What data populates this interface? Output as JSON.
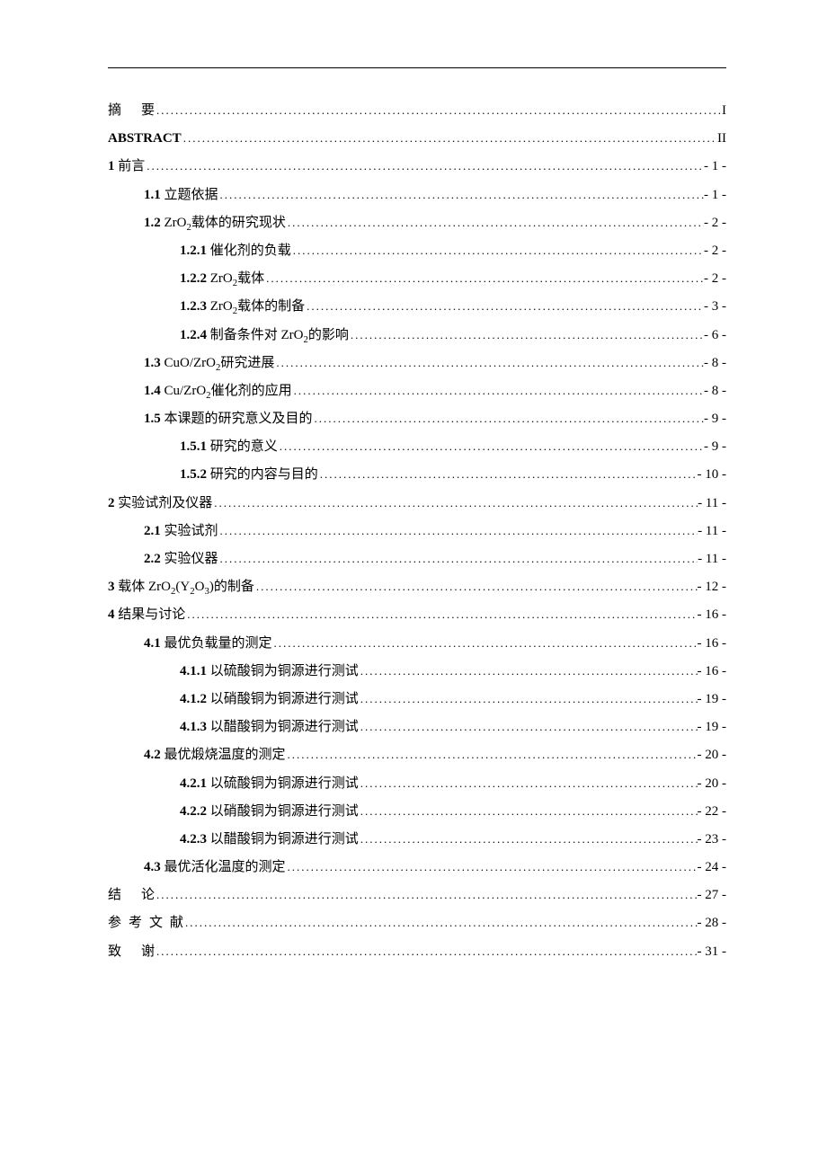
{
  "toc": [
    {
      "level": 0,
      "num": "",
      "title_html": "<span class='spaced-2'>摘</span>要",
      "title_bold": false,
      "page": "I"
    },
    {
      "level": 0,
      "num": "",
      "title_html": "<b>ABSTRACT</b>",
      "title_bold": true,
      "page": "II"
    },
    {
      "level": 0,
      "num": "1",
      "title_html": "前言",
      "title_bold": false,
      "page": "- 1 -"
    },
    {
      "level": 1,
      "num": "1.1",
      "title_html": " 立题依据",
      "title_bold": false,
      "page": "- 1 -"
    },
    {
      "level": 1,
      "num": "1.2",
      "title_html": " ZrO<sub>2</sub>载体的研究现状",
      "title_bold": false,
      "page": "- 2 -"
    },
    {
      "level": 2,
      "num": "1.2.1",
      "title_html": " 催化剂的负载",
      "title_bold": false,
      "page": "- 2 -"
    },
    {
      "level": 2,
      "num": "1.2.2",
      "title_html": " ZrO<sub>2</sub>载体",
      "title_bold": false,
      "page": "- 2 -"
    },
    {
      "level": 2,
      "num": "1.2.3",
      "title_html": " ZrO<sub>2</sub>载体的制备",
      "title_bold": false,
      "page": "- 3 -"
    },
    {
      "level": 2,
      "num": "1.2.4",
      "title_html": " 制备条件对 ZrO<sub>2</sub>的影响",
      "title_bold": false,
      "page": "- 6 -"
    },
    {
      "level": 1,
      "num": "1.3",
      "title_html": " CuO/ZrO<sub>2</sub>研究进展",
      "title_bold": false,
      "page": "- 8 -"
    },
    {
      "level": 1,
      "num": "1.4",
      "title_html": " Cu/ZrO<sub>2</sub>催化剂的应用",
      "title_bold": false,
      "page": "- 8 -"
    },
    {
      "level": 1,
      "num": "1.5",
      "title_html": " 本课题的研究意义及目的",
      "title_bold": false,
      "page": "- 9 -"
    },
    {
      "level": 2,
      "num": "1.5.1",
      "title_html": " 研究的意义",
      "title_bold": false,
      "page": "- 9 -"
    },
    {
      "level": 2,
      "num": "1.5.2",
      "title_html": " 研究的内容与目的",
      "title_bold": false,
      "page": "- 10 -"
    },
    {
      "level": 0,
      "num": "2",
      "title_html": "实验试剂及仪器",
      "title_bold": false,
      "page": "- 11 -"
    },
    {
      "level": 1,
      "num": "2.1",
      "title_html": " 实验试剂",
      "title_bold": false,
      "page": "- 11 -"
    },
    {
      "level": 1,
      "num": "2.2",
      "title_html": " 实验仪器",
      "title_bold": false,
      "page": "- 11 -"
    },
    {
      "level": 0,
      "num": "3",
      "title_html": "载体 ZrO<sub>2</sub>(Y<sub>2</sub>O<sub>3</sub>)的制备",
      "title_bold": false,
      "page": "- 12 -"
    },
    {
      "level": 0,
      "num": "4",
      "title_html": "结果与讨论",
      "title_bold": false,
      "page": "- 16 -"
    },
    {
      "level": 1,
      "num": "4.1",
      "title_html": " 最优负载量的测定",
      "title_bold": false,
      "page": "- 16 -"
    },
    {
      "level": 2,
      "num": "4.1.1",
      "title_html": " 以硫酸铜为铜源进行测试",
      "title_bold": false,
      "page": "- 16 -"
    },
    {
      "level": 2,
      "num": "4.1.2",
      "title_html": " 以硝酸铜为铜源进行测试",
      "title_bold": false,
      "page": "- 19 -"
    },
    {
      "level": 2,
      "num": "4.1.3",
      "title_html": " 以醋酸铜为铜源进行测试",
      "title_bold": false,
      "page": "- 19 -"
    },
    {
      "level": 1,
      "num": "4.2",
      "title_html": " 最优煅烧温度的测定",
      "title_bold": false,
      "page": "- 20 -"
    },
    {
      "level": 2,
      "num": "4.2.1",
      "title_html": " 以硫酸铜为铜源进行测试",
      "title_bold": false,
      "page": "- 20 -"
    },
    {
      "level": 2,
      "num": "4.2.2",
      "title_html": " 以硝酸铜为铜源进行测试",
      "title_bold": false,
      "page": "- 22 -"
    },
    {
      "level": 2,
      "num": "4.2.3",
      "title_html": " 以醋酸铜为铜源进行测试",
      "title_bold": false,
      "page": "- 23 -"
    },
    {
      "level": 1,
      "num": "4.3",
      "title_html": " 最优活化温度的测定",
      "title_bold": false,
      "page": "- 24 -"
    },
    {
      "level": 0,
      "num": "",
      "title_html": "<span class='spaced-2'>结</span>论",
      "title_bold": false,
      "page": "- 27 -"
    },
    {
      "level": 0,
      "num": "",
      "title_html": "<span class='spaced-4'>参考文</span>献",
      "title_bold": false,
      "page": "- 28 -"
    },
    {
      "level": 0,
      "num": "",
      "title_html": "<span class='spaced-2'>致</span>谢",
      "title_bold": false,
      "page": "- 31 -"
    }
  ]
}
